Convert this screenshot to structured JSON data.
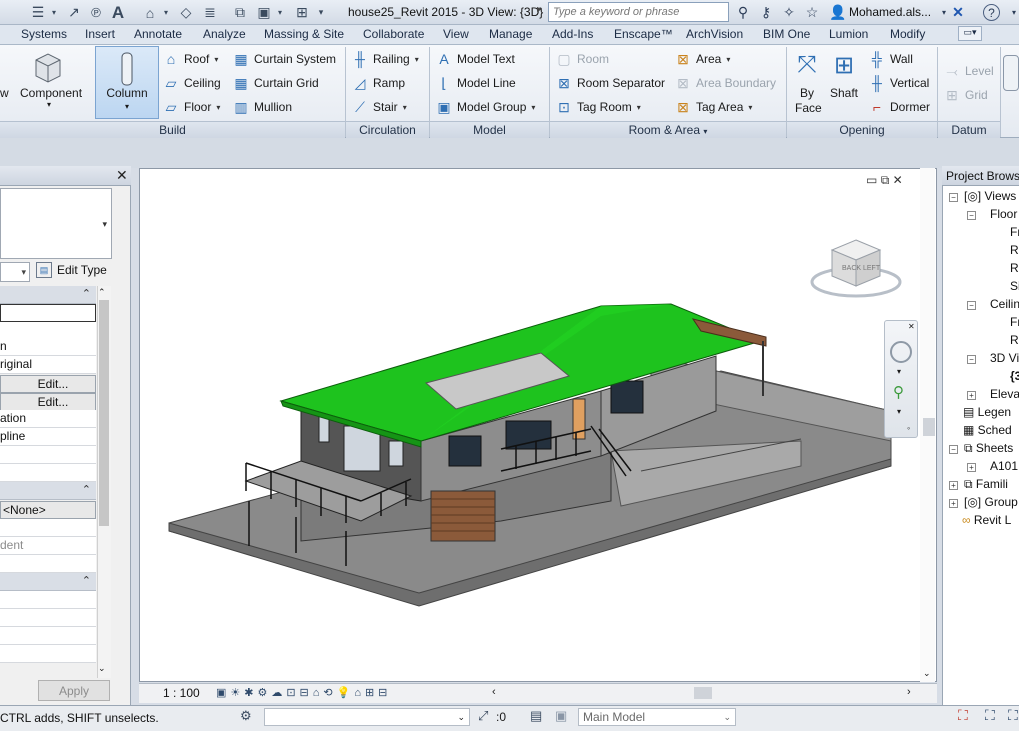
{
  "title_bar": {
    "file_title": "house25_Revit 2015 - 3D View: {3D}",
    "search_placeholder": "Type a keyword or phrase",
    "user": "Mohamed.als...",
    "qat_icons": [
      "workplane-icon",
      "dimension-icon",
      "tag-icon",
      "text-icon",
      "3d-view-icon",
      "section-icon",
      "thin-lines-icon",
      "close-hidden-icon",
      "switch-windows-icon"
    ]
  },
  "tabs": [
    "Systems",
    "Insert",
    "Annotate",
    "Analyze",
    "Massing & Site",
    "Collaborate",
    "View",
    "Manage",
    "Add-Ins",
    "Enscape™",
    "ArchVision",
    "BIM One",
    "Lumion",
    "Modify"
  ],
  "ribbon": {
    "build": {
      "label": "Build",
      "wall_partial": "w",
      "component": "Component",
      "column": "Column",
      "roof": "Roof",
      "ceiling": "Ceiling",
      "floor": "Floor",
      "curtain_system": "Curtain System",
      "curtain_grid": "Curtain Grid",
      "mullion": "Mullion"
    },
    "circulation": {
      "label": "Circulation",
      "railing": "Railing",
      "ramp": "Ramp",
      "stair": "Stair"
    },
    "model": {
      "label": "Model",
      "model_text": "Model Text",
      "model_line": "Model Line",
      "model_group": "Model Group"
    },
    "room_area": {
      "label": "Room & Area",
      "room": "Room",
      "room_separator": "Room Separator",
      "tag_room": "Tag Room",
      "area": "Area",
      "area_boundary": "Area Boundary",
      "tag_area": "Tag Area"
    },
    "opening": {
      "label": "Opening",
      "by_face_1": "By",
      "by_face_2": "Face",
      "shaft": "Shaft",
      "wall": "Wall",
      "vertical": "Vertical",
      "dormer": "Dormer"
    },
    "datum": {
      "label": "Datum",
      "level": "Level",
      "grid": "Grid"
    }
  },
  "properties": {
    "edit_type": "Edit Type",
    "rows": [
      "",
      "n",
      "riginal",
      "Edit...",
      "Edit...",
      "ation",
      "pline",
      ""
    ],
    "none_value": "<None>",
    "dependent": "dent",
    "apply": "Apply"
  },
  "viewport": {
    "scale": "1 : 100",
    "cube_top": "TOP",
    "cube_back": "BACK",
    "cube_left": "LEFT"
  },
  "browser": {
    "title": "Project Browser",
    "items": [
      "Views",
      "Floor",
      "Fr",
      "Ro",
      "Ro",
      "Si",
      "Ceilin",
      "Fr",
      "Ro",
      "3D Vi",
      "{3",
      "Elevat",
      "Legen",
      "Sched",
      "Sheets",
      "A101",
      "Famili",
      "Group",
      "Revit L"
    ]
  },
  "status": {
    "message": "CTRL adds, SHIFT unselects.",
    "count": ":0",
    "model": "Main Model"
  },
  "colors": {
    "roof_green": "#1ec31e",
    "accent_blue": "#2f6fb3"
  }
}
